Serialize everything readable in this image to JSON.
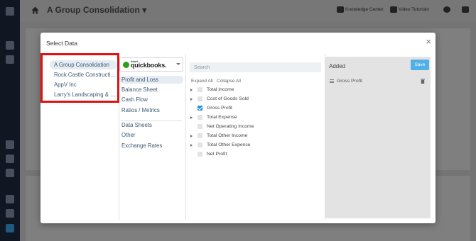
{
  "app": {
    "title": "A Group Consolidation",
    "header_links": [
      "Knowledge Center",
      "Video Tutorials"
    ]
  },
  "modal": {
    "title": "Select Data",
    "close": "×"
  },
  "companies": [
    {
      "label": "A Group Consolidation",
      "selected": true
    },
    {
      "label": "Rock Castle Constructi…",
      "selected": false
    },
    {
      "label": "AppV Inc",
      "selected": false
    },
    {
      "label": "Larry's Landscaping & …",
      "selected": false
    }
  ],
  "source": {
    "intuit": "intuit",
    "name": "quickbooks."
  },
  "categories_group1": [
    {
      "label": "Profit and Loss",
      "selected": true
    },
    {
      "label": "Balance Sheet",
      "selected": false
    },
    {
      "label": "Cash Flow",
      "selected": false
    },
    {
      "label": "Ratios / Metrics",
      "selected": false
    }
  ],
  "categories_group2": [
    {
      "label": "Data Sheets"
    },
    {
      "label": "Other"
    },
    {
      "label": "Exchange Rates"
    }
  ],
  "search": {
    "placeholder": "Search"
  },
  "tree_actions": {
    "expand_all": "Expand All",
    "collapse_all": "Collapse All"
  },
  "tree": [
    {
      "label": "Total Income",
      "expandable": true,
      "checked": false
    },
    {
      "label": "Cost of Goods Sold",
      "expandable": true,
      "checked": false
    },
    {
      "label": "Gross Profit",
      "expandable": false,
      "checked": true
    },
    {
      "label": "Total Expense",
      "expandable": true,
      "checked": false
    },
    {
      "label": "Net Operating Income",
      "expandable": false,
      "checked": false
    },
    {
      "label": "Total Other Income",
      "expandable": true,
      "checked": false
    },
    {
      "label": "Total Other Expense",
      "expandable": true,
      "checked": false
    },
    {
      "label": "Net Profit",
      "expandable": false,
      "checked": false
    }
  ],
  "added": {
    "title": "Added",
    "save_label": "Save",
    "items": [
      "Gross Profit"
    ]
  },
  "colors": {
    "accent": "#4fb1e8",
    "highlight": "#e01111",
    "checked": "#2f8fd8",
    "link_text": "#3d5a75"
  }
}
